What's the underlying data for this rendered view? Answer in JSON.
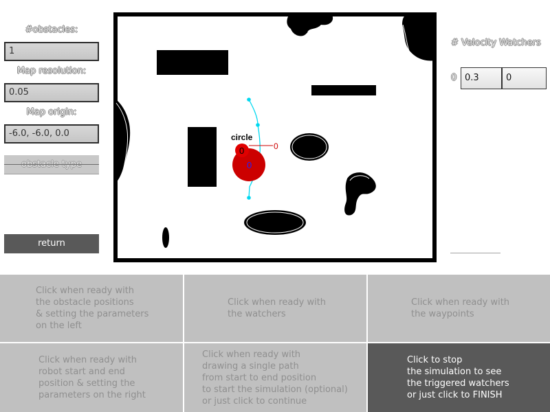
{
  "left_panel": {
    "obstacles_label": "#obstacles:",
    "obstacles_value": "1",
    "map_resolution_label": "Map resolution:",
    "map_resolution_value": "0.05",
    "map_origin_label": "Map origin:",
    "map_origin_value": "-6.0, -6.0, 0.0",
    "obstacle_type_label": "obstacle type",
    "return_label": "return"
  },
  "right_panel": {
    "title": "# Velocity Watchers",
    "row_index": "0",
    "velocity_value": "0.3",
    "second_value": "0"
  },
  "map": {
    "obstacle_name": "circle",
    "robot_start_label": "0",
    "robot_end_label": "0",
    "velocity_label": "0",
    "colors": {
      "robot": "#cc0000",
      "path": "#00d8f0",
      "velocity_text": "#2020ff",
      "walls": "#000000"
    }
  },
  "steps": [
    {
      "text": "Click when ready with\nthe obstacle positions\n& setting the parameters\non the left",
      "active": false
    },
    {
      "text": "Click when ready with\nthe watchers",
      "active": false
    },
    {
      "text": "Click when ready with\nthe waypoints",
      "active": false
    },
    {
      "text": "Click when ready with\nrobot start and end\nposition & setting the\nparameters on the right",
      "active": false
    },
    {
      "text": "Click when ready with\ndrawing a single path\nfrom start to end position\nto start the simulation (optional)\nor just click to continue",
      "active": false
    },
    {
      "text": "Click to stop\nthe simulation to see\nthe triggered watchers\nor just click to FINISH",
      "active": true
    }
  ]
}
